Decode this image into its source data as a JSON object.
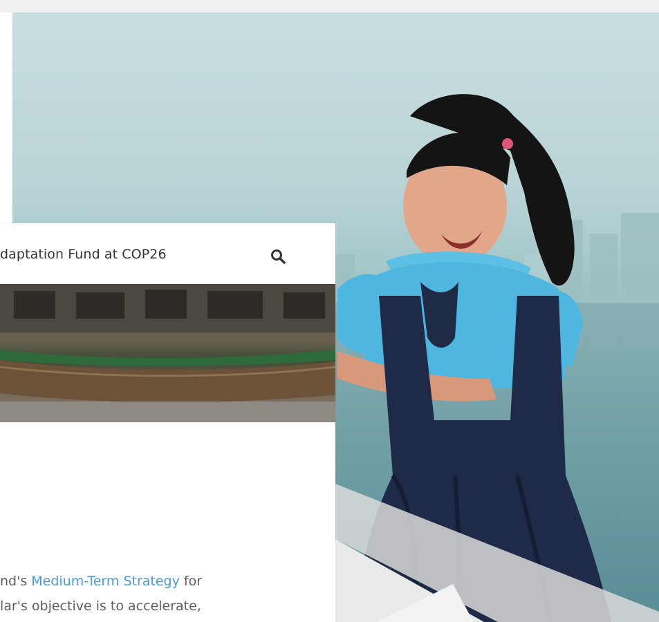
{
  "header": {
    "link_text": "daptation Fund at COP26",
    "search_icon": "search-icon"
  },
  "article": {
    "line1_prefix": "nd's ",
    "line1_link": "Medium-Term Strategy",
    "line1_suffix": " for",
    "line2": "lar's objective is to accelerate,"
  },
  "colors": {
    "link": "#4a9cd6",
    "text": "#5f5f5f",
    "background": "#f1f1f1"
  }
}
